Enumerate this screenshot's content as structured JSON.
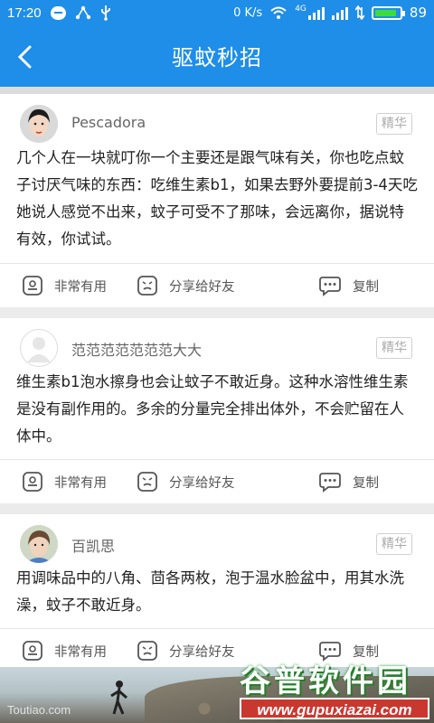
{
  "status_bar": {
    "time": "17:20",
    "net_speed": "0 K/s",
    "network_type": "4G",
    "battery_level": "89"
  },
  "header": {
    "title": "驱蚊秒招",
    "back_icon": "chevron-left-icon"
  },
  "colors": {
    "header_bg": "#1e8ee8",
    "battery_fill": "#3ddc3d"
  },
  "posts": [
    {
      "username": "Pescadora",
      "badge": "精华",
      "content": "几个人在一块就叮你一个主要还是跟气味有关，你也吃点蚊子讨厌气味的东西：吃维生素b1，如果去野外要提前3-4天吃她说人感觉不出来，蚊子可受不了那味，会远离你，据说特有效，你试试。",
      "actions": [
        "非常有用",
        "分享给好友",
        "复制"
      ]
    },
    {
      "username": "范范范范范范范大大",
      "badge": "精华",
      "content": "维生素b1泡水擦身也会让蚊子不敢近身。这种水溶性维生素是没有副作用的。多余的分量完全排出体外，不会贮留在人体中。",
      "actions": [
        "非常有用",
        "分享给好友",
        "复制"
      ]
    },
    {
      "username": "百凯思",
      "badge": "精华",
      "content": "用调味品中的八角、茴各两枚，泡于温水脸盆中，用其水洗澡，蚊子不敢近身。",
      "actions": [
        "非常有用",
        "分享给好友",
        "复制"
      ]
    }
  ],
  "ad": {
    "watermark": "Toutiao.com",
    "brand_name": "谷普软件园",
    "brand_url": "www.gupuxiazai.com"
  }
}
